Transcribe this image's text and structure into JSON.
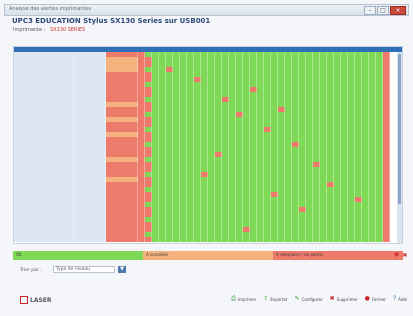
{
  "window": {
    "title": "Analyse des alertes imprimantes",
    "controls": [
      "–",
      "□",
      "×"
    ]
  },
  "header": {
    "title": "UPC3 EDUCATION Stylus SX130 Series sur USB001"
  },
  "filter": {
    "label": "Imprimante :",
    "link": "SX130 SERIES"
  },
  "legend": {
    "items": [
      {
        "label": "OK",
        "color": "#7ed957"
      },
      {
        "label": "A surveiller",
        "color": "#f6b27e"
      },
      {
        "label": "A remplacer / en panne",
        "color": "#ee7a6c"
      }
    ]
  },
  "sort": {
    "label": "Trier par :",
    "selected": "Type de niveau",
    "button": "▼"
  },
  "footer": {
    "brand": "LASER",
    "actions": [
      {
        "label": "Imprimer",
        "icon": "printer-icon",
        "color": "green"
      },
      {
        "label": "Exporter",
        "icon": "export-icon",
        "color": "green"
      },
      {
        "label": "Configurer",
        "icon": "configure-icon",
        "color": "green"
      },
      {
        "label": "Supprimer",
        "icon": "delete-icon",
        "color": "red"
      },
      {
        "label": "Fermer",
        "icon": "close-icon",
        "color": "red"
      },
      {
        "label": "Aide",
        "icon": "help-icon",
        "color": "blue"
      }
    ]
  },
  "colors": {
    "header_bar": "#2f6fb8",
    "ok": "#7ed957",
    "warn": "#f6b27e",
    "alert": "#ee7a6c",
    "row_label_bg": "#dde7f4",
    "row_label_text": "#aeb9c8"
  },
  "grid": {
    "row_count": 38,
    "warn_status_rows": [
      1,
      2,
      3,
      10,
      13,
      16,
      21,
      25
    ],
    "alert_cells": [
      [
        3,
        4
      ],
      [
        5,
        8
      ],
      [
        9,
        12
      ],
      [
        12,
        14
      ],
      [
        15,
        18
      ],
      [
        18,
        22
      ],
      [
        22,
        25
      ],
      [
        26,
        27
      ],
      [
        29,
        31
      ],
      [
        33,
        35
      ],
      [
        7,
        16
      ],
      [
        11,
        20
      ],
      [
        20,
        11
      ],
      [
        24,
        9
      ],
      [
        28,
        19
      ],
      [
        31,
        23
      ],
      [
        35,
        15
      ]
    ]
  }
}
